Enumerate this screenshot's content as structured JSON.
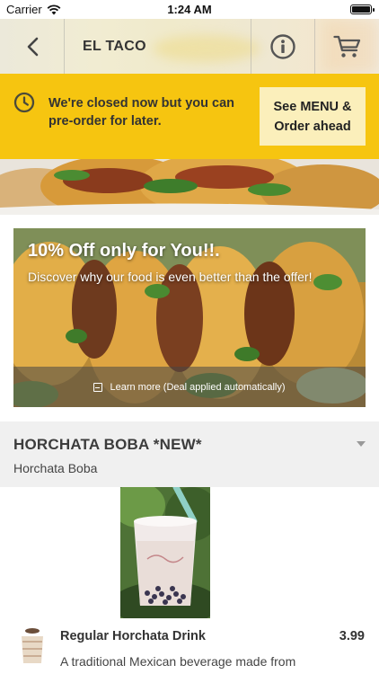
{
  "status_bar": {
    "carrier": "Carrier",
    "time": "1:24 AM"
  },
  "nav": {
    "title": "EL TACO",
    "icons": [
      "chevron-left-icon",
      "info-icon",
      "cart-icon"
    ]
  },
  "closed_banner": {
    "message_line1": "We're closed now but you can",
    "message_line2": "pre-order for later.",
    "button_line1": "See MENU &",
    "button_line2": "Order ahead",
    "background_color": "#f6c510"
  },
  "offer": {
    "title": "10% Off only for You!!.",
    "subtitle": "Discover why our food is even better than the offer!",
    "footer_text": "Learn more (Deal applied automatically)"
  },
  "category": {
    "title": "HORCHATA BOBA *NEW*",
    "subtitle": "Horchata Boba"
  },
  "items": [
    {
      "name": "Regular Horchata Drink",
      "price": "3.99",
      "description": "A traditional Mexican beverage made from"
    }
  ]
}
